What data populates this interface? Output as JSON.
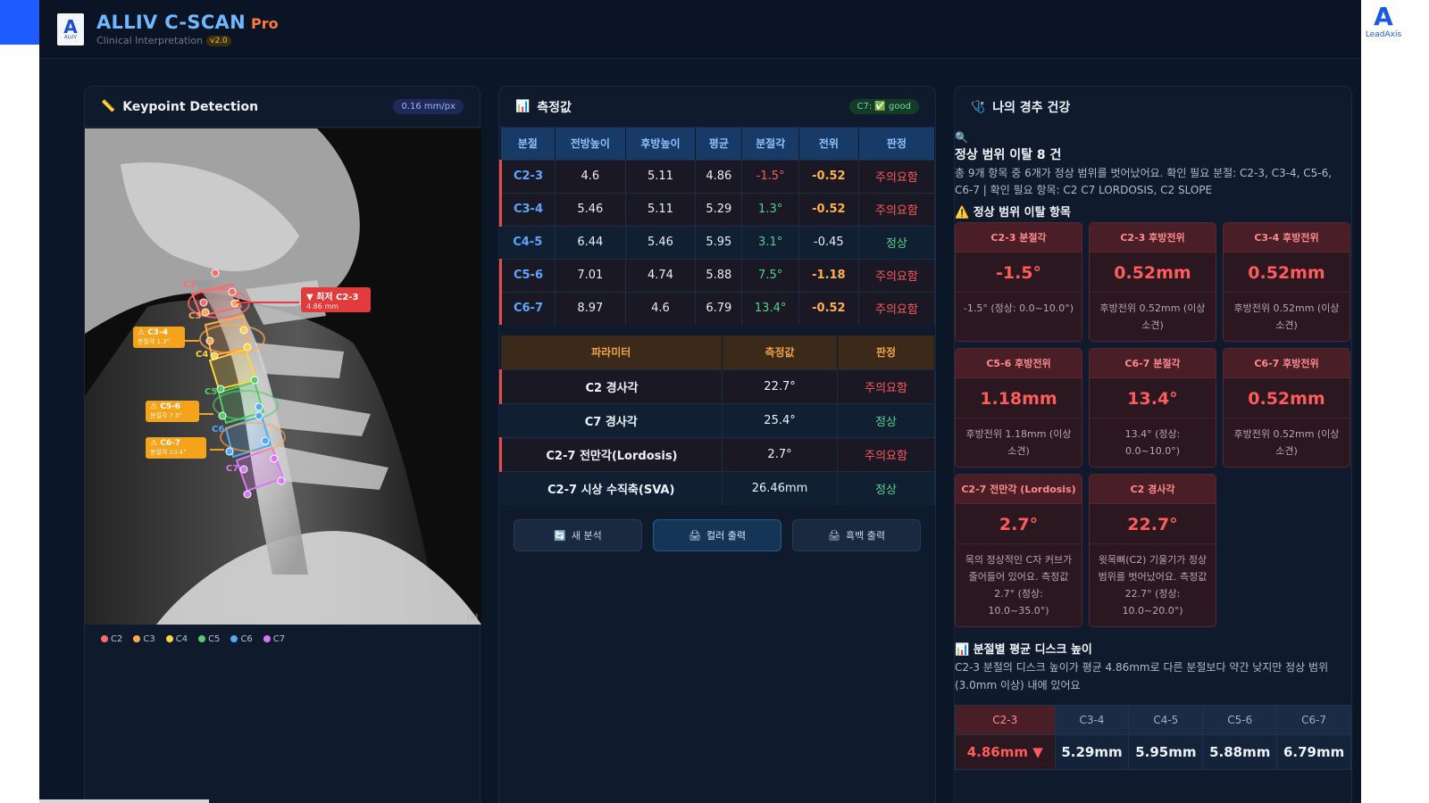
{
  "app": {
    "title": "ALLIV C-SCAN",
    "edition": "Pro",
    "subtitle": "Clinical Interpretation",
    "version": "v2.0",
    "logo_text": "A",
    "logo_small": "ALLIV",
    "corner_brand": "LeadAxis"
  },
  "keypoint": {
    "title": "Keypoint Detection",
    "icon": "ruler-icon",
    "scale": "0.16 mm/px",
    "badge_corner": "[6]",
    "annotations": {
      "min": "▼ 최저 C2-3",
      "min_val": "4.86 mm",
      "c34": "⚠ C3-4",
      "c34_sub": "분절각 1.3°",
      "c56": "⚠ C5-6",
      "c56_sub": "분절각 7.5°",
      "c67": "⚠ C6-7",
      "c67_sub": "분절각 13.4°"
    },
    "vertebra_labels": [
      "C2",
      "C3",
      "C4",
      "C5",
      "C6",
      "C7"
    ],
    "legend": [
      {
        "label": "C2",
        "color": "#ff6b6b"
      },
      {
        "label": "C3",
        "color": "#ffa94d"
      },
      {
        "label": "C4",
        "color": "#ffd43b"
      },
      {
        "label": "C5",
        "color": "#51cf66"
      },
      {
        "label": "C6",
        "color": "#4dabf7"
      },
      {
        "label": "C7",
        "color": "#da77f2"
      }
    ]
  },
  "measure": {
    "title": "측정값",
    "icon": "bar-chart-icon",
    "badge": "C7: ✅ good",
    "headers": [
      "분절",
      "전방높이",
      "후방높이",
      "평균",
      "분절각",
      "전위",
      "판정"
    ],
    "rows": [
      {
        "seg": "C2-3",
        "ant": "4.6",
        "post": "5.11",
        "avg": "4.86",
        "angle": "-1.5°",
        "shift": "-0.52",
        "verdict": "주의요함",
        "bad": true,
        "angle_cls": "red",
        "shift_cls": "orange",
        "verdict_cls": "red"
      },
      {
        "seg": "C3-4",
        "ant": "5.46",
        "post": "5.11",
        "avg": "5.29",
        "angle": "1.3°",
        "shift": "-0.52",
        "verdict": "주의요함",
        "bad": true,
        "angle_cls": "green",
        "shift_cls": "orange",
        "verdict_cls": "red"
      },
      {
        "seg": "C4-5",
        "ant": "6.44",
        "post": "5.46",
        "avg": "5.95",
        "angle": "3.1°",
        "shift": "-0.45",
        "verdict": "정상",
        "bad": false,
        "angle_cls": "green",
        "shift_cls": "",
        "verdict_cls": "green"
      },
      {
        "seg": "C5-6",
        "ant": "7.01",
        "post": "4.74",
        "avg": "5.88",
        "angle": "7.5°",
        "shift": "-1.18",
        "verdict": "주의요함",
        "bad": true,
        "angle_cls": "green",
        "shift_cls": "orange",
        "verdict_cls": "red"
      },
      {
        "seg": "C6-7",
        "ant": "8.97",
        "post": "4.6",
        "avg": "6.79",
        "angle": "13.4°",
        "shift": "-0.52",
        "verdict": "주의요함",
        "bad": true,
        "angle_cls": "green",
        "shift_cls": "orange",
        "verdict_cls": "red"
      }
    ],
    "param_headers": [
      "파라미터",
      "측정값",
      "판정"
    ],
    "params": [
      {
        "name": "C2 경사각",
        "value": "22.7°",
        "verdict": "주의요함",
        "bad": true
      },
      {
        "name": "C7 경사각",
        "value": "25.4°",
        "verdict": "정상",
        "bad": false
      },
      {
        "name": "C2-7 전만각(Lordosis)",
        "value": "2.7°",
        "verdict": "주의요함",
        "bad": true
      },
      {
        "name": "C2-7 시상 수직축(SVA)",
        "value": "26.46mm",
        "verdict": "정상",
        "bad": false
      }
    ],
    "buttons": {
      "new": "새 분석",
      "color_print": "컬러 출력",
      "bw_print": "흑백 출력"
    }
  },
  "health": {
    "title": "나의 경추 건강",
    "icon": "stethoscope-icon",
    "out_title": "정상 범위 이탈 8 건",
    "out_desc": "총 9개 항목 중 6개가 정상 범위를 벗어났어요. 확인 필요 분절: C2-3, C3-4, C5-6, C6-7 | 확인 필요 항목: C2 C7 LORDOSIS, C2 SLOPE",
    "warn_title": "정상 범위 이탈 항목",
    "cards": [
      {
        "head": "C2-3 분절각",
        "value": "-1.5°",
        "desc": "-1.5° (정상: 0.0~10.0°)"
      },
      {
        "head": "C2-3 후방전위",
        "value": "0.52mm",
        "desc": "후방전위 0.52mm (이상소견)"
      },
      {
        "head": "C3-4 후방전위",
        "value": "0.52mm",
        "desc": "후방전위 0.52mm (이상소견)"
      },
      {
        "head": "C5-6 후방전위",
        "value": "1.18mm",
        "desc": "후방전위 1.18mm (이상소견)"
      },
      {
        "head": "C6-7 분절각",
        "value": "13.4°",
        "desc": "13.4° (정상: 0.0~10.0°)"
      },
      {
        "head": "C6-7 후방전위",
        "value": "0.52mm",
        "desc": "후방전위 0.52mm (이상소견)"
      },
      {
        "head": "C2-7 전만각 (Lordosis)",
        "value": "2.7°",
        "desc": "목의 정상적인 C자 커브가 줄어들어 있어요. 측정값 2.7° (정상: 10.0~35.0°)"
      },
      {
        "head": "C2 경사각",
        "value": "22.7°",
        "desc": "윗목뼈(C2) 기울기가 정상 범위를 벗어났어요. 측정값 22.7° (정상: 10.0~20.0°)"
      }
    ],
    "disc_title": "분절별 평균 디스크 높이",
    "disc_desc": "C2-3 분절의 디스크 높이가 평균 4.86mm로 다른 분절보다 약간 낮지만 정상 범위(3.0mm 이상) 내에 있어요",
    "disc": [
      {
        "seg": "C2-3",
        "val": "4.86mm ▼",
        "hl": true
      },
      {
        "seg": "C3-4",
        "val": "5.29mm",
        "hl": false
      },
      {
        "seg": "C4-5",
        "val": "5.95mm",
        "hl": false
      },
      {
        "seg": "C5-6",
        "val": "5.88mm",
        "hl": false
      },
      {
        "seg": "C6-7",
        "val": "6.79mm",
        "hl": false
      }
    ]
  }
}
